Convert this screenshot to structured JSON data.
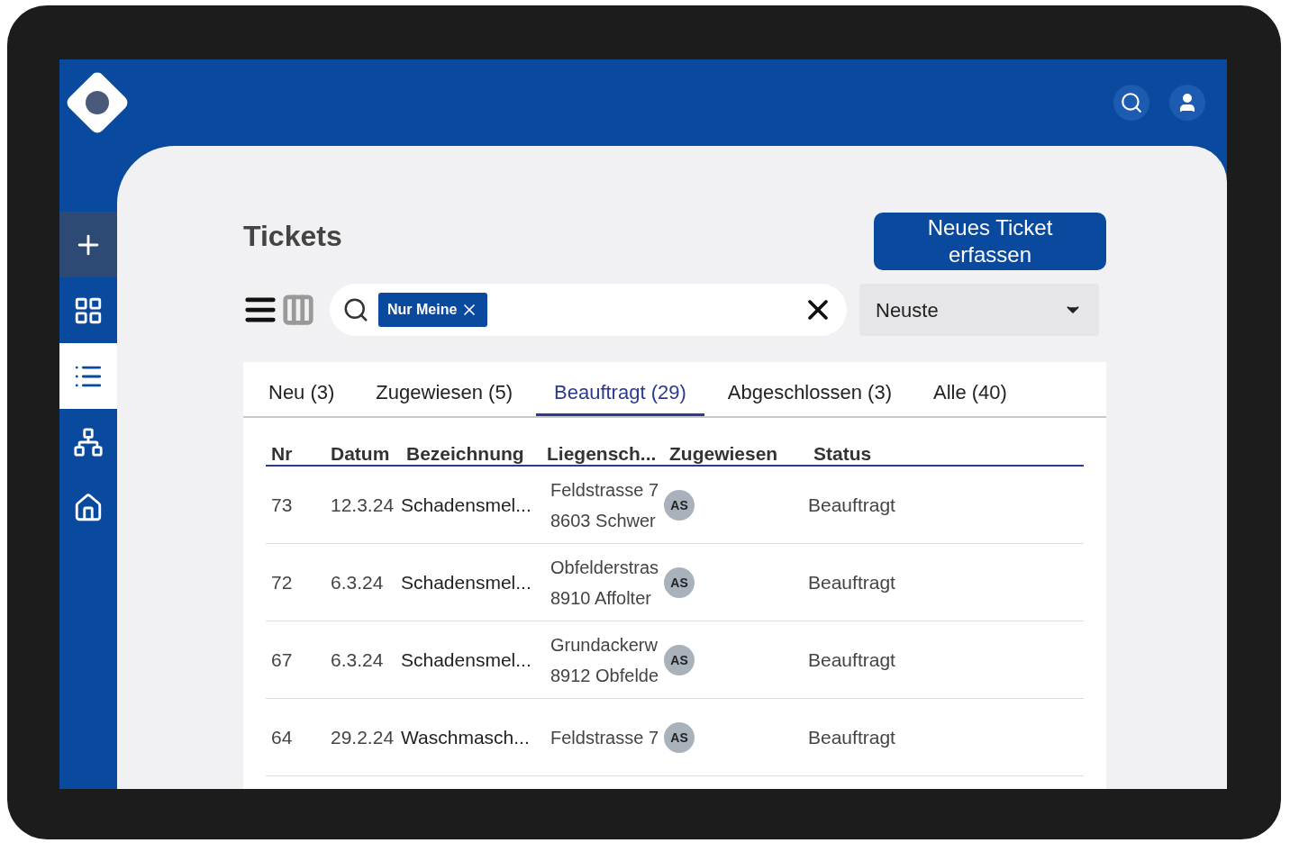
{
  "page": {
    "title": "Tickets",
    "new_button": "Neues Ticket erfassen"
  },
  "sidebar": {
    "items": [
      {
        "kind": "plus",
        "selected": false
      },
      {
        "kind": "grid",
        "selected": false
      },
      {
        "kind": "list",
        "selected": true
      },
      {
        "kind": "network",
        "selected": false
      },
      {
        "kind": "home",
        "selected": false
      }
    ]
  },
  "search": {
    "chips": [
      "Nur Meine"
    ]
  },
  "sort": {
    "value": "Neuste"
  },
  "view_toggle": [
    {
      "kind": "list",
      "selected": true
    },
    {
      "kind": "columns",
      "selected": false
    }
  ],
  "tabs": [
    {
      "label": "Neu (3)",
      "selected": false
    },
    {
      "label": "Zugewiesen (5)",
      "selected": false
    },
    {
      "label": "Beauftragt (29)",
      "selected": true
    },
    {
      "label": "Abgeschlossen (3)",
      "selected": false
    },
    {
      "label": "Alle (40)",
      "selected": false
    }
  ],
  "table": {
    "columns": [
      "Nr",
      "Datum",
      "Bezeichnung",
      "Liegensch...",
      "Zugewiesen",
      "Status"
    ],
    "rows": [
      {
        "nr": "73",
        "date": "12.3.24",
        "title": "Schadensmel...",
        "address": [
          "Feldstrasse 7",
          "8603 Schwer"
        ],
        "assignee": "AS",
        "status": "Beauftragt"
      },
      {
        "nr": "72",
        "date": "6.3.24",
        "title": "Schadensmel...",
        "address": [
          "Obfelderstras",
          "8910 Affolter"
        ],
        "assignee": "AS",
        "status": "Beauftragt"
      },
      {
        "nr": "67",
        "date": "6.3.24",
        "title": "Schadensmel...",
        "address": [
          "Grundackerw",
          "8912 Obfelde"
        ],
        "assignee": "AS",
        "status": "Beauftragt"
      },
      {
        "nr": "64",
        "date": "29.2.24",
        "title": "Waschmasch...",
        "address": [
          "Feldstrasse 7"
        ],
        "assignee": "AS",
        "status": "Beauftragt"
      }
    ]
  }
}
